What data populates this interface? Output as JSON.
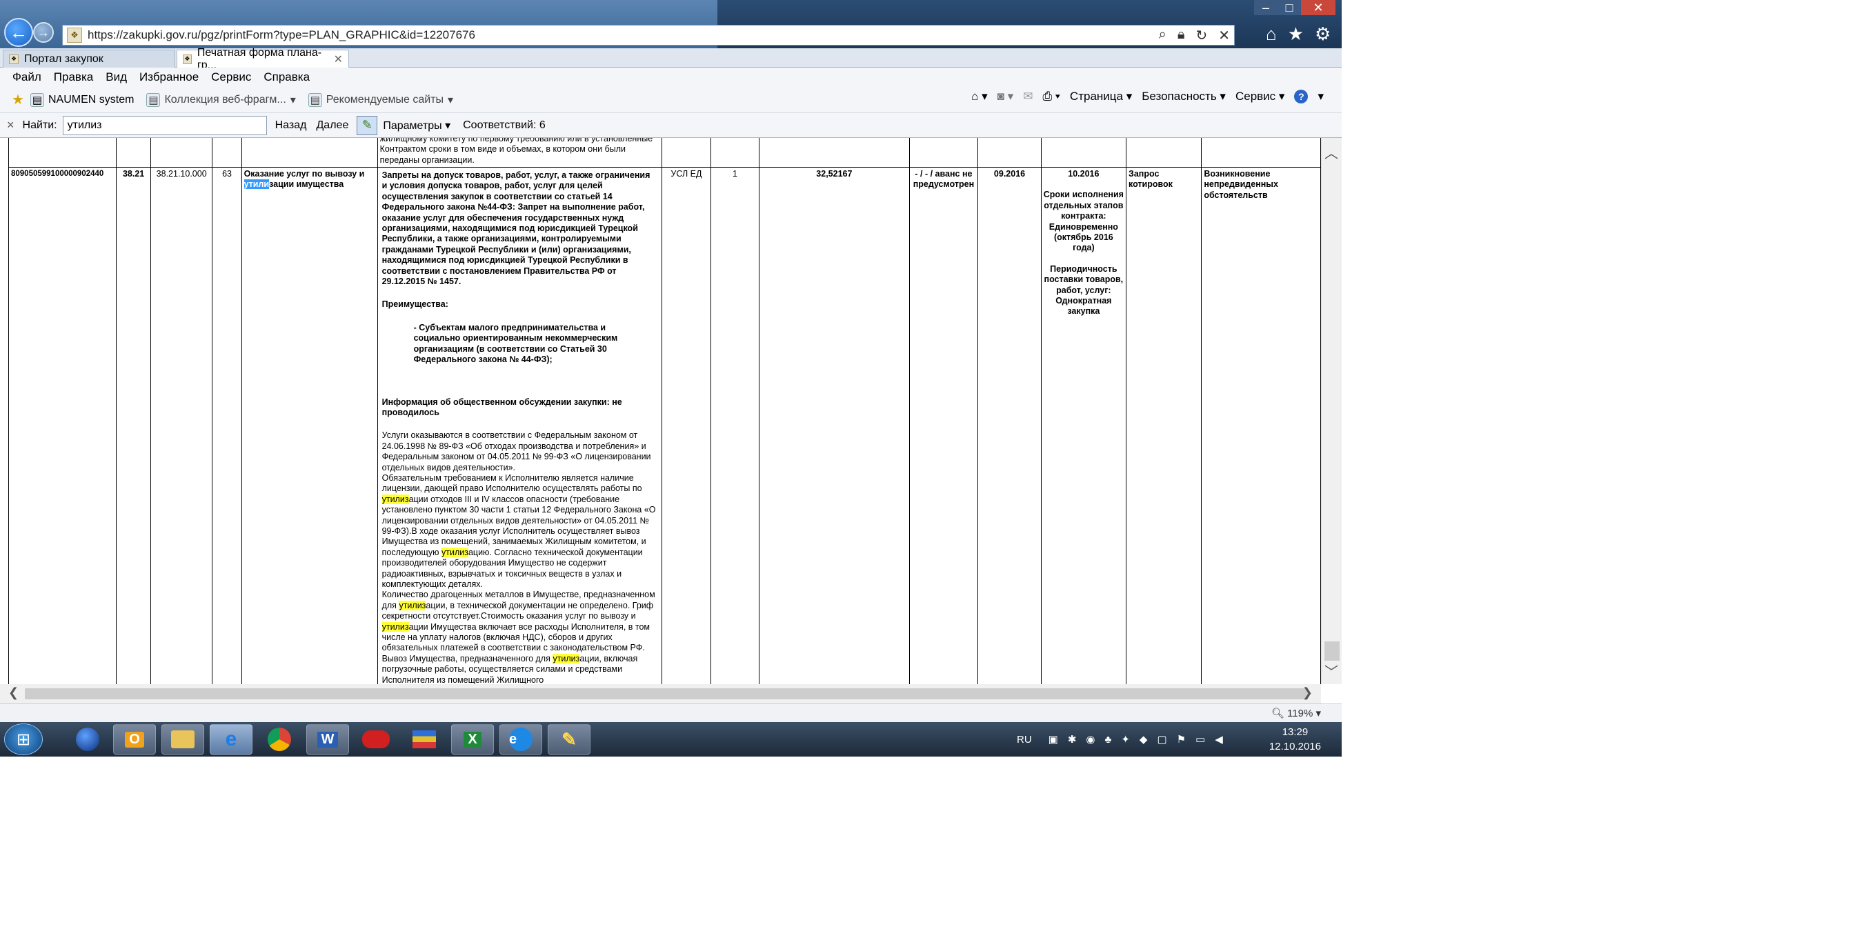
{
  "browser": {
    "url": "https://zakupki.gov.ru/pgz/printForm?type=PLAN_GRAPHIC&id=12207676",
    "tabs": [
      {
        "label": "Портал закупок"
      },
      {
        "label": "Печатная форма плана-гр..."
      }
    ],
    "menu": [
      "Файл",
      "Правка",
      "Вид",
      "Избранное",
      "Сервис",
      "Справка"
    ],
    "favorites": [
      {
        "label": "NAUMEN system"
      },
      {
        "label": "Коллекция веб-фрагм..."
      },
      {
        "label": "Рекомендуемые сайты"
      }
    ],
    "commands": [
      "Страница",
      "Безопасность",
      "Сервис"
    ],
    "find": {
      "close": "×",
      "label": "Найти:",
      "value": "утилиз",
      "prev": "Назад",
      "next": "Далее",
      "options": "Параметры",
      "matches": "Соответствий: 6"
    },
    "zoom": "119%"
  },
  "document": {
    "top_fragment": "жилищному комитету по первому требованию или в установленные Контрактом сроки в том виде и объемах, в котором они были переданы организации.",
    "row": {
      "code": "809050599100000902440",
      "okved": "38.21",
      "okpd": "38.21.10.000",
      "num": "63",
      "name_pre": "Оказание услуг по вывозу и ",
      "name_hl": "утили",
      "name_post": "зации имущества",
      "bans": "Запреты на допуск товаров, работ, услуг, а также ограничения и условия допуска товаров, работ, услуг для целей осуществления закупок в соответствии со статьей 14 Федерального закона №44-ФЗ: Запрет на выполнение работ, оказание услуг для обеспечения государственных нужд организациями, находящимися под юрисдикцией Турецкой Республики, а также организациями, контролируемыми гражданами Турецкой Республики и (или) организациями, находящимися под юрисдикцией Турецкой Республики в соответствии с постановлением Правительства РФ от 29.12.2015 № 1457.",
      "advantages_title": "Преимущества:",
      "advantages_text": "- Субъектам малого предпринимательства и социально ориентированным некоммерческим организациям (в соответствии со Статьей 30 Федерального закона № 44-ФЗ);",
      "discussion": "Информация об общественном обсуждении закупки: не проводилось",
      "desc_parts": [
        {
          "t": "Услуги оказываются в соответствии с Федеральным законом от 24.06.1998 № 89-ФЗ «Об отходах производства и потребления» и Федеральным законом от 04.05.2011 № 99-ФЗ «О лицензировании отдельных видов деятельности».\nОбязательным требованием к Исполнителю является наличие лицензии, дающей право Исполнителю осуществлять работы по "
        },
        {
          "t": "утилиз",
          "hl": true
        },
        {
          "t": "ации отходов III и IV классов опасности (требование установлено пунктом 30 части 1 статьи 12 Федерального Закона «О лицензировании отдельных видов деятельности» от 04.05.2011 № 99-ФЗ).В ходе оказания услуг Исполнитель осуществляет вывоз Имущества из помещений, занимаемых Жилищным комитетом, и последующую "
        },
        {
          "t": "утилиз",
          "hl": true
        },
        {
          "t": "ацию. Согласно технической документации производителей оборудования Имущество не содержит радиоактивных, взрывчатых и токсичных веществ в узлах и комплектующих деталях.\nКоличество драгоценных металлов в Имуществе, предназначенном для "
        },
        {
          "t": "утилиз",
          "hl": true
        },
        {
          "t": "ации, в технической документации не определено. Гриф секретности отсутствует.Стоимость оказания услуг по вывозу и "
        },
        {
          "t": "утилиз",
          "hl": true
        },
        {
          "t": "ации Имущества включает все расходы Исполнителя, в том числе на уплату налогов (включая НДС), сборов и других обязательных платежей в соответствии с законодательством РФ. Вывоз Имущества, предназначенного для "
        },
        {
          "t": "утилиз",
          "hl": true
        },
        {
          "t": "ации, включая погрузочные работы, осуществляется силами и средствами Исполнителя из помещений Жилищного"
        }
      ],
      "unit": "УСЛ ЕД",
      "qty": "1",
      "price": "32,52167",
      "advance": "- / - / аванс не предусмотрен",
      "start": "09.2016",
      "end": "10.2016",
      "stages": "Сроки исполнения отдельных этапов контракта: Единовременно (октябрь 2016 года)",
      "periodicity": "Периодичность поставки товаров, работ, услуг: Однократная закупка",
      "method": "Запрос котировок",
      "reason": "Возникновение непредвиденных обстоятельств"
    }
  },
  "taskbar": {
    "lang": "RU",
    "time": "13:29",
    "date": "12.10.2016"
  },
  "colors": {
    "highlight": "#ffff33",
    "selection": "#3399ff",
    "taskbar": "#1d2a3a"
  }
}
